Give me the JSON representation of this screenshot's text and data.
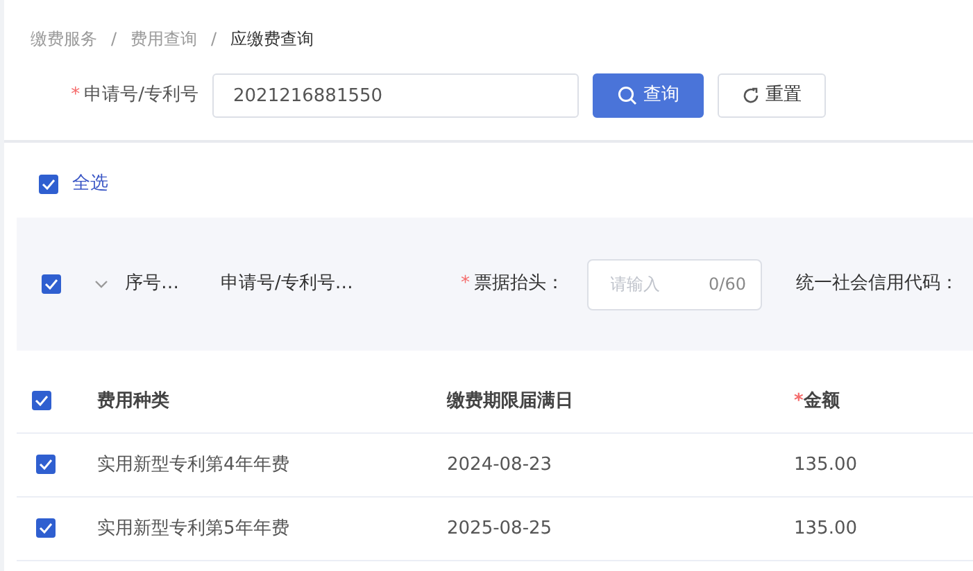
{
  "breadcrumb_separator": "/",
  "breadcrumb": [
    {
      "label": "缴费服务",
      "current": false
    },
    {
      "label": "费用查询",
      "current": false
    },
    {
      "label": "应缴费查询",
      "current": true
    }
  ],
  "search": {
    "label": "申请号/专利号",
    "required_mark": "*",
    "value": "2021216881550"
  },
  "buttons": [
    {
      "label": "查询",
      "kind": "primary"
    },
    {
      "label": "重置",
      "kind": "reset"
    }
  ],
  "select_all": {
    "label": "全选",
    "checked": true
  },
  "group": {
    "checked": true,
    "expanded": false,
    "fields": [
      "序号…",
      "申请号/专利号…"
    ],
    "invoice_title": {
      "label": "票据抬头：",
      "required_mark": "*",
      "placeholder": "请输入",
      "counter": "0/60"
    },
    "credit_code_label": "统一社会信用代码："
  },
  "table": {
    "all_checked": true,
    "columns": [
      {
        "label": "费用种类"
      },
      {
        "label": "缴费期限届满日"
      },
      {
        "label": "金额",
        "required_mark": "*"
      }
    ],
    "rows": [
      {
        "checked": true,
        "cells": [
          "实用新型专利第4年年费",
          "2024-08-23",
          "135.00"
        ]
      },
      {
        "checked": true,
        "cells": [
          "实用新型专利第5年年费",
          "2025-08-25",
          "135.00"
        ]
      }
    ]
  }
}
